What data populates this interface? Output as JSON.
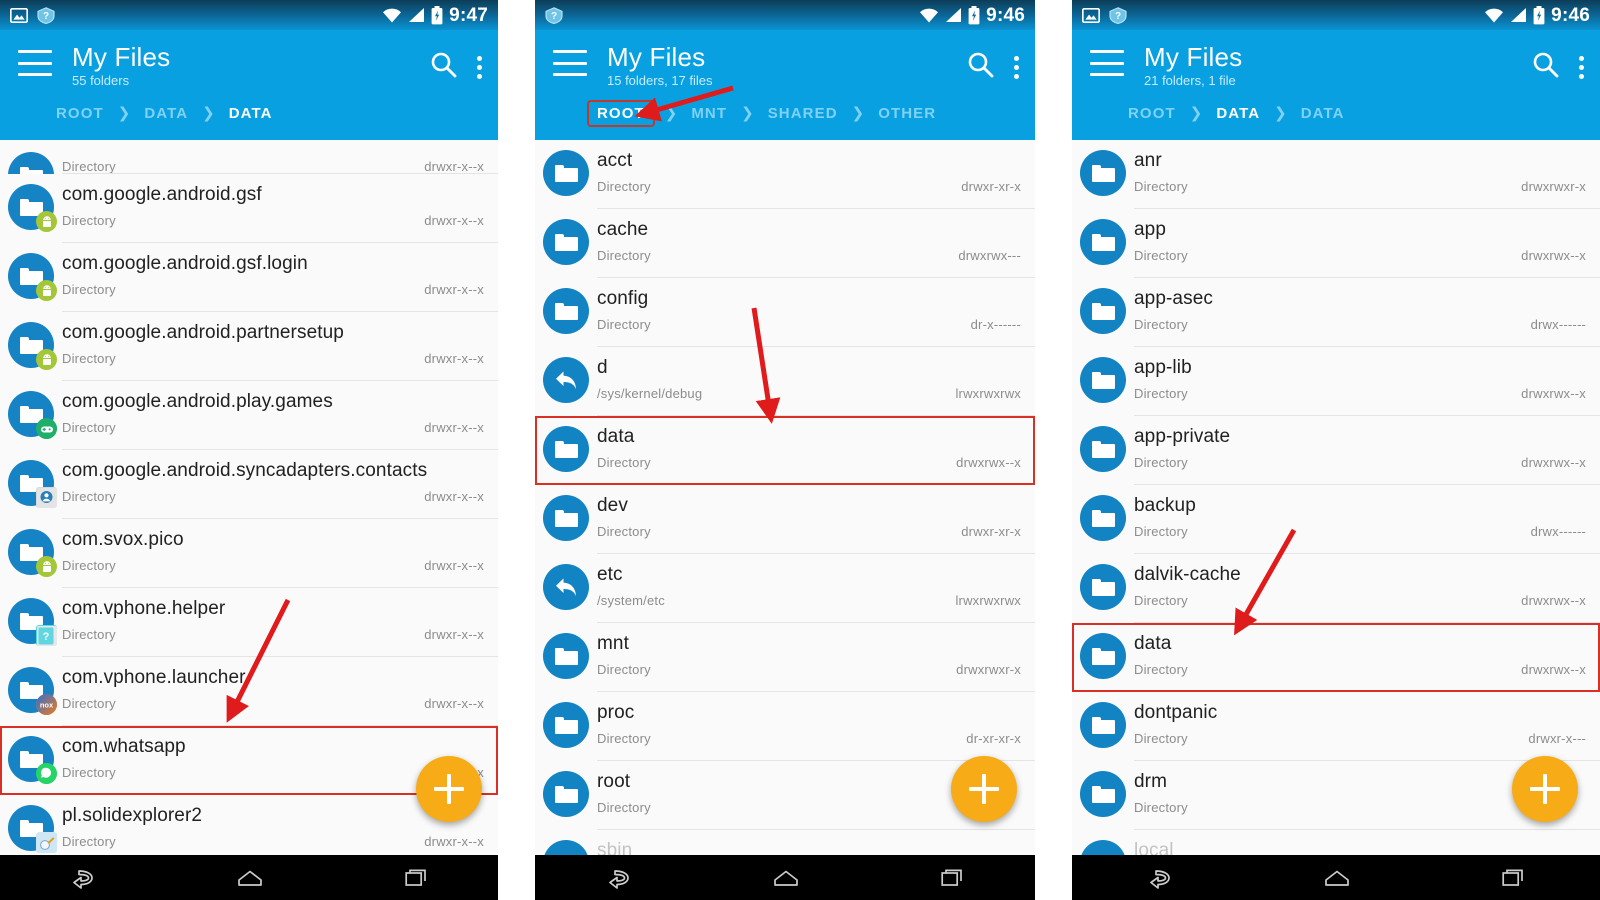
{
  "meta": {
    "app_name": "My Files",
    "accent_blue": "#09a0e2",
    "statusbar_blue": "#0b6a9c",
    "highlight_red": "#d93025",
    "fab_amber": "#f7ab17",
    "icon_blue": "#1683c4"
  },
  "icons": {
    "hamburger": "hamburger-icon",
    "search": "search-icon",
    "overflow": "kebab-menu-icon",
    "wifi": "wifi-icon",
    "signal": "signal-bars-icon",
    "battery": "battery-charging-icon",
    "back": "nav-back-icon",
    "home": "nav-home-icon",
    "recents": "nav-recents-icon",
    "fab": "add-plus-icon",
    "folder": "folder-icon",
    "symlink": "symlink-arrow-icon"
  },
  "panels": [
    {
      "id": "panel-1",
      "status": {
        "time": "9:47",
        "left_icons": [
          "screenshot-icon",
          "unknown-help-icon"
        ]
      },
      "appbar": {
        "title": "My Files",
        "subtitle": "55 folders"
      },
      "breadcrumbs": [
        {
          "label": "ROOT",
          "state": "inactive"
        },
        {
          "label": "DATA",
          "state": "inactive"
        },
        {
          "label": "DATA",
          "state": "active"
        }
      ],
      "rows": [
        {
          "name": "",
          "type": "Directory",
          "perm": "drwxr-x--x",
          "icon": "folder",
          "badge": "play-store-badge",
          "badge_color": "#f1f1f1",
          "partial": "top"
        },
        {
          "name": "com.google.android.gsf",
          "type": "Directory",
          "perm": "drwxr-x--x",
          "icon": "folder",
          "badge": "android-badge",
          "badge_color": "#a4c639"
        },
        {
          "name": "com.google.android.gsf.login",
          "type": "Directory",
          "perm": "drwxr-x--x",
          "icon": "folder",
          "badge": "android-badge",
          "badge_color": "#a4c639"
        },
        {
          "name": "com.google.android.partnersetup",
          "type": "Directory",
          "perm": "drwxr-x--x",
          "icon": "folder",
          "badge": "android-badge",
          "badge_color": "#a4c639"
        },
        {
          "name": "com.google.android.play.games",
          "type": "Directory",
          "perm": "drwxr-x--x",
          "icon": "folder",
          "badge": "play-games-badge",
          "badge_color": "#1faf6a"
        },
        {
          "name": "com.google.android.syncadapters.contacts",
          "type": "Directory",
          "perm": "drwxr-x--x",
          "icon": "folder",
          "badge": "contacts-badge",
          "badge_color": "#d8d8d8"
        },
        {
          "name": "com.svox.pico",
          "type": "Directory",
          "perm": "drwxr-x--x",
          "icon": "folder",
          "badge": "android-badge",
          "badge_color": "#a4c639"
        },
        {
          "name": "com.vphone.helper",
          "type": "Directory",
          "perm": "drwxr-x--x",
          "icon": "folder",
          "badge": "help-badge",
          "badge_color": "#56d8e0"
        },
        {
          "name": "com.vphone.launcher",
          "type": "Directory",
          "perm": "drwxr-x--x",
          "icon": "folder",
          "badge": "nox-badge",
          "badge_color": "#e8761e"
        },
        {
          "name": "com.whatsapp",
          "type": "Directory",
          "perm": "drwxr-x--x",
          "icon": "folder",
          "badge": "whatsapp-badge",
          "badge_color": "#25d366",
          "highlighted": true
        },
        {
          "name": "pl.solidexplorer2",
          "type": "Directory",
          "perm": "drwxr-x--x",
          "icon": "folder",
          "badge": "solid-explorer-badge",
          "badge_color": "#cfe6f5"
        }
      ]
    },
    {
      "id": "panel-2",
      "status": {
        "time": "9:46",
        "left_icons": [
          "unknown-help-icon"
        ]
      },
      "appbar": {
        "title": "My Files",
        "subtitle": "15 folders, 17 files"
      },
      "breadcrumbs": [
        {
          "label": "ROOT",
          "state": "boxed"
        },
        {
          "label": "MNT",
          "state": "inactive"
        },
        {
          "label": "SHARED",
          "state": "inactive"
        },
        {
          "label": "OTHER",
          "state": "inactive"
        }
      ],
      "rows": [
        {
          "name": "acct",
          "type": "Directory",
          "perm": "drwxr-xr-x",
          "icon": "folder"
        },
        {
          "name": "cache",
          "type": "Directory",
          "perm": "drwxrwx---",
          "icon": "folder"
        },
        {
          "name": "config",
          "type": "Directory",
          "perm": "dr-x------",
          "icon": "folder"
        },
        {
          "name": "d",
          "type": "/sys/kernel/debug",
          "perm": "lrwxrwxrwx",
          "icon": "symlink"
        },
        {
          "name": "data",
          "type": "Directory",
          "perm": "drwxrwx--x",
          "icon": "folder",
          "highlighted": true
        },
        {
          "name": "dev",
          "type": "Directory",
          "perm": "drwxr-xr-x",
          "icon": "folder"
        },
        {
          "name": "etc",
          "type": "/system/etc",
          "perm": "lrwxrwxrwx",
          "icon": "symlink"
        },
        {
          "name": "mnt",
          "type": "Directory",
          "perm": "drwxrwxr-x",
          "icon": "folder"
        },
        {
          "name": "proc",
          "type": "Directory",
          "perm": "dr-xr-xr-x",
          "icon": "folder"
        },
        {
          "name": "root",
          "type": "Directory",
          "perm": "",
          "icon": "folder"
        },
        {
          "name": "sbin",
          "type": "",
          "perm": "",
          "icon": "folder",
          "partial": "bottom"
        }
      ]
    },
    {
      "id": "panel-3",
      "status": {
        "time": "9:46",
        "left_icons": [
          "screenshot-icon",
          "unknown-help-icon"
        ]
      },
      "appbar": {
        "title": "My Files",
        "subtitle": "21 folders, 1 file"
      },
      "breadcrumbs": [
        {
          "label": "ROOT",
          "state": "inactive"
        },
        {
          "label": "DATA",
          "state": "active"
        },
        {
          "label": "DATA",
          "state": "inactive"
        }
      ],
      "rows": [
        {
          "name": "anr",
          "type": "Directory",
          "perm": "drwxrwxr-x",
          "icon": "folder"
        },
        {
          "name": "app",
          "type": "Directory",
          "perm": "drwxrwx--x",
          "icon": "folder"
        },
        {
          "name": "app-asec",
          "type": "Directory",
          "perm": "drwx------",
          "icon": "folder"
        },
        {
          "name": "app-lib",
          "type": "Directory",
          "perm": "drwxrwx--x",
          "icon": "folder"
        },
        {
          "name": "app-private",
          "type": "Directory",
          "perm": "drwxrwx--x",
          "icon": "folder"
        },
        {
          "name": "backup",
          "type": "Directory",
          "perm": "drwx------",
          "icon": "folder"
        },
        {
          "name": "dalvik-cache",
          "type": "Directory",
          "perm": "drwxrwx--x",
          "icon": "folder"
        },
        {
          "name": "data",
          "type": "Directory",
          "perm": "drwxrwx--x",
          "icon": "folder",
          "highlighted": true
        },
        {
          "name": "dontpanic",
          "type": "Directory",
          "perm": "drwxr-x---",
          "icon": "folder"
        },
        {
          "name": "drm",
          "type": "Directory",
          "perm": "",
          "icon": "folder"
        },
        {
          "name": "local",
          "type": "",
          "perm": "",
          "icon": "folder",
          "partial": "bottom"
        }
      ]
    }
  ]
}
